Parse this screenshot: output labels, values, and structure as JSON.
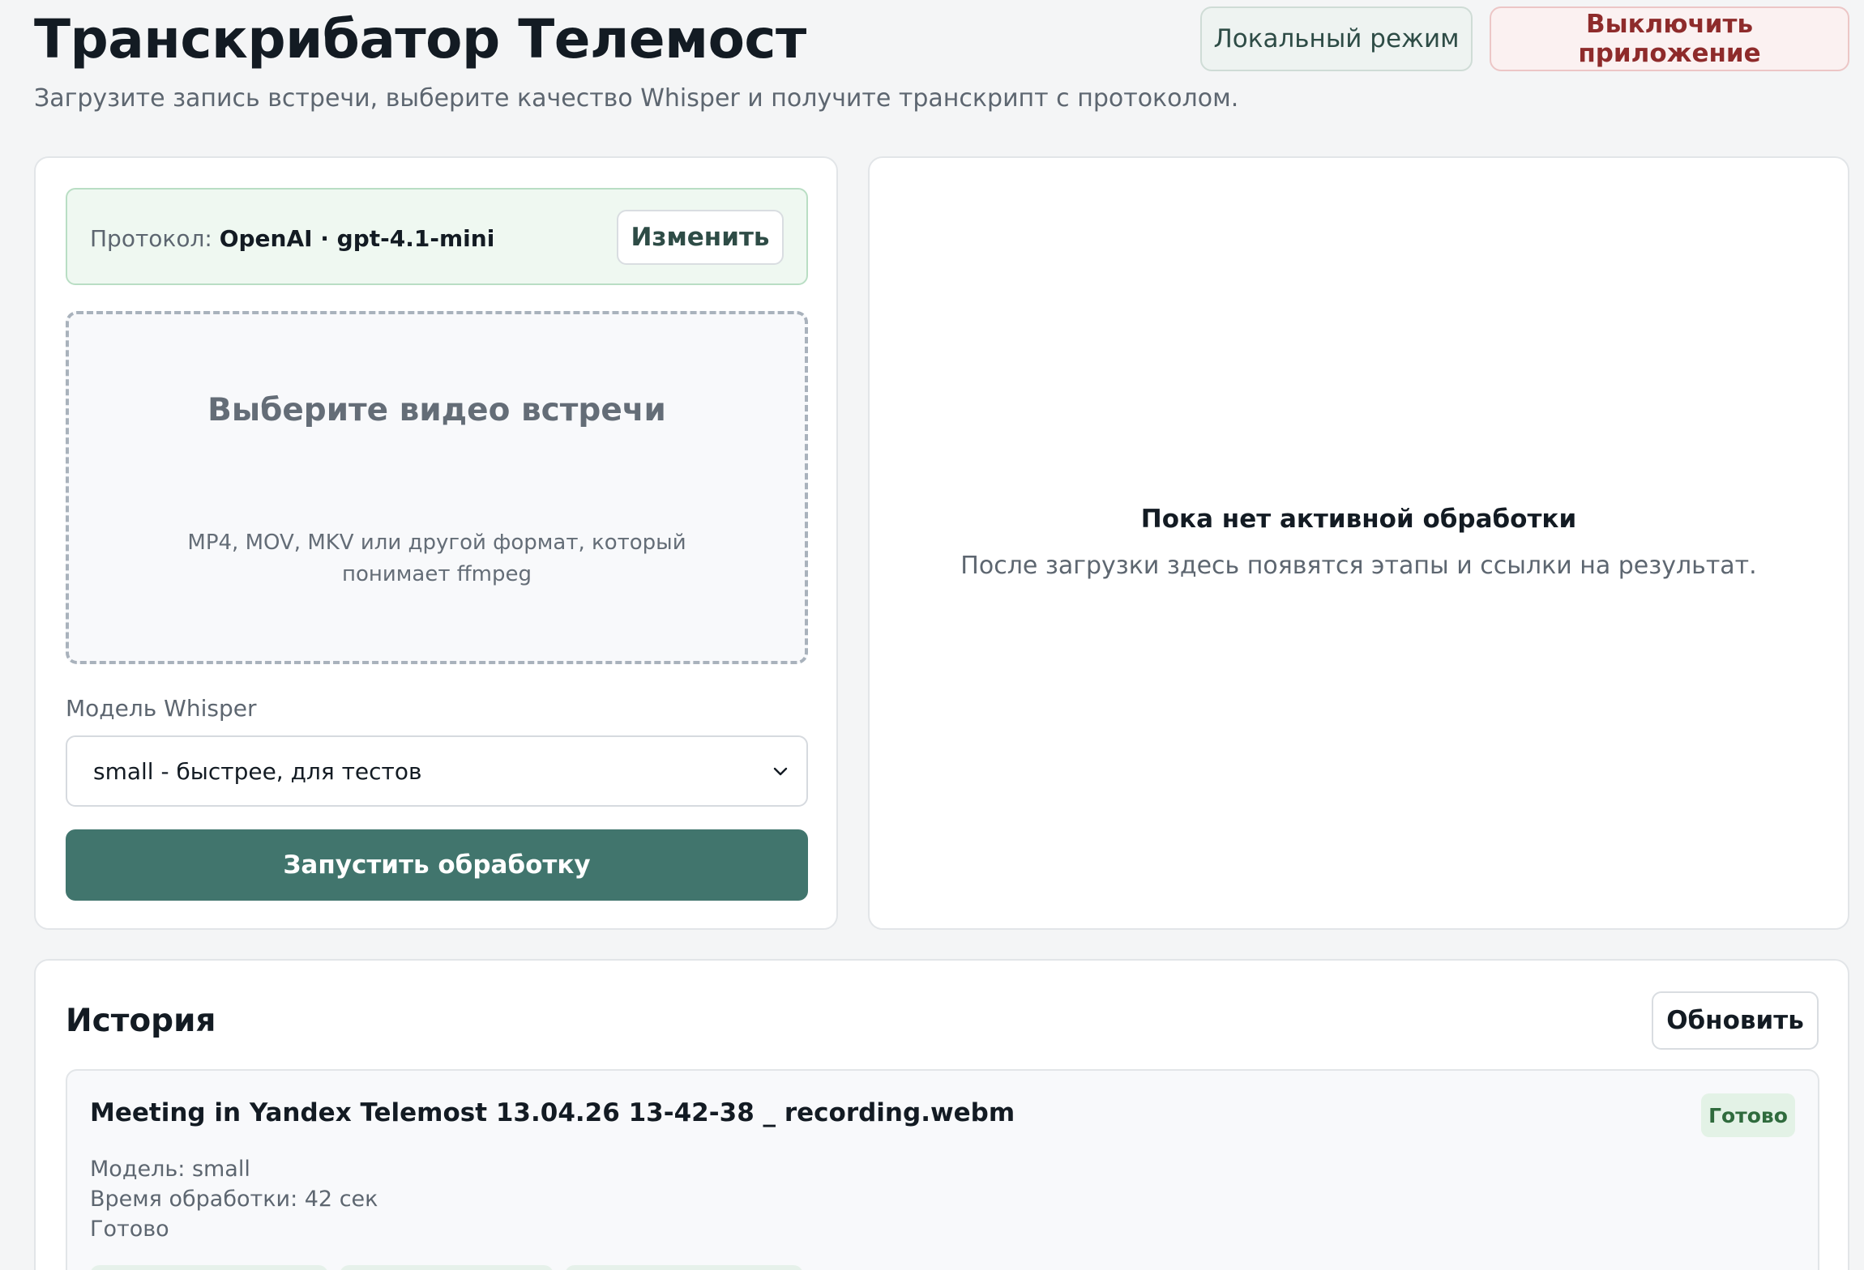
{
  "header": {
    "title": "Транскрибатор Телемост",
    "subtitle": "Загрузите запись встречи, выберите качество Whisper и получите транскрипт с протоколом.",
    "local_mode_label": "Локальный режим",
    "quit_label": "Выключить приложение"
  },
  "upload": {
    "protocol_label": "Протокол: ",
    "protocol_value": "OpenAI · gpt-4.1-mini",
    "change_label": "Изменить",
    "dropzone_title": "Выберите видео встречи",
    "dropzone_hint": "MP4, MOV, MKV или другой формат, который понимает ffmpeg",
    "model_label": "Модель Whisper",
    "model_selected": "small - быстрее, для тестов",
    "start_label": "Запустить обработку"
  },
  "status_panel": {
    "empty_title": "Пока нет активной обработки",
    "empty_text": "После загрузки здесь появятся этапы и ссылки на результат."
  },
  "history": {
    "title": "История",
    "refresh_label": "Обновить",
    "items": [
      {
        "title": "Meeting in Yandex Telemost 13.04.26 13-42-38 _ recording.webm",
        "status": "Готово",
        "model": "Модель: small",
        "duration": "Время обработки: 42 сек",
        "state": "Готово"
      }
    ]
  },
  "colors": {
    "accent": "#41756d",
    "danger": "#8e2b2b",
    "success_bg": "#e3f2e6",
    "success_text": "#2f6b3d"
  },
  "icons": {
    "select_chevron": "chevron-down-icon"
  }
}
